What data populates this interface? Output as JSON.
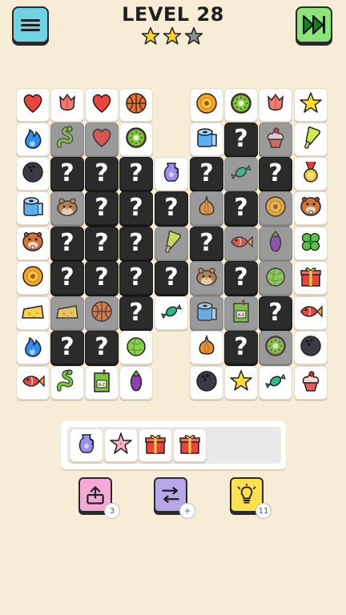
{
  "header": {
    "level_label": "LEVEL 28",
    "menu_icon": "hamburger-menu-icon",
    "skip_icon": "fast-forward-ad-icon",
    "stars_earned": 2,
    "stars_total": 3
  },
  "board": {
    "columns": 9,
    "rows": 9,
    "tiles": [
      {
        "row": 0,
        "col": 0,
        "item": "heart",
        "state": "open"
      },
      {
        "row": 0,
        "col": 1,
        "item": "tulip",
        "state": "open"
      },
      {
        "row": 0,
        "col": 2,
        "item": "heart",
        "state": "open"
      },
      {
        "row": 0,
        "col": 3,
        "item": "basketball",
        "state": "open"
      },
      {
        "row": 0,
        "col": 5,
        "item": "sunflower",
        "state": "open"
      },
      {
        "row": 0,
        "col": 6,
        "item": "kiwi",
        "state": "open"
      },
      {
        "row": 0,
        "col": 7,
        "item": "tulip",
        "state": "open"
      },
      {
        "row": 0,
        "col": 8,
        "item": "star",
        "state": "open"
      },
      {
        "row": 1,
        "col": 0,
        "item": "fire",
        "state": "open"
      },
      {
        "row": 1,
        "col": 1,
        "item": "snake",
        "state": "dim"
      },
      {
        "row": 1,
        "col": 2,
        "item": "heart",
        "state": "dim"
      },
      {
        "row": 1,
        "col": 3,
        "item": "kiwi",
        "state": "open"
      },
      {
        "row": 1,
        "col": 5,
        "item": "toilet-paper",
        "state": "open"
      },
      {
        "row": 1,
        "col": 6,
        "item": "",
        "state": "hidden"
      },
      {
        "row": 1,
        "col": 7,
        "item": "cupcake",
        "state": "dim"
      },
      {
        "row": 1,
        "col": 8,
        "item": "popsicle",
        "state": "open"
      },
      {
        "row": 2,
        "col": 0,
        "item": "bowling-ball",
        "state": "open"
      },
      {
        "row": 2,
        "col": 1,
        "item": "",
        "state": "hidden"
      },
      {
        "row": 2,
        "col": 2,
        "item": "",
        "state": "hidden"
      },
      {
        "row": 2,
        "col": 3,
        "item": "",
        "state": "hidden"
      },
      {
        "row": 2,
        "col": 4,
        "item": "vase",
        "state": "open"
      },
      {
        "row": 2,
        "col": 5,
        "item": "",
        "state": "hidden"
      },
      {
        "row": 2,
        "col": 6,
        "item": "candy",
        "state": "dim"
      },
      {
        "row": 2,
        "col": 7,
        "item": "",
        "state": "hidden"
      },
      {
        "row": 2,
        "col": 8,
        "item": "medal",
        "state": "open"
      },
      {
        "row": 3,
        "col": 0,
        "item": "toilet-paper",
        "state": "open"
      },
      {
        "row": 3,
        "col": 1,
        "item": "hamster",
        "state": "dim"
      },
      {
        "row": 3,
        "col": 2,
        "item": "",
        "state": "hidden"
      },
      {
        "row": 3,
        "col": 3,
        "item": "",
        "state": "hidden"
      },
      {
        "row": 3,
        "col": 4,
        "item": "",
        "state": "hidden"
      },
      {
        "row": 3,
        "col": 5,
        "item": "onion",
        "state": "dim"
      },
      {
        "row": 3,
        "col": 6,
        "item": "",
        "state": "hidden"
      },
      {
        "row": 3,
        "col": 7,
        "item": "sunflower",
        "state": "dim"
      },
      {
        "row": 3,
        "col": 8,
        "item": "beaver",
        "state": "open"
      },
      {
        "row": 4,
        "col": 0,
        "item": "beaver",
        "state": "open"
      },
      {
        "row": 4,
        "col": 1,
        "item": "",
        "state": "hidden"
      },
      {
        "row": 4,
        "col": 2,
        "item": "",
        "state": "hidden"
      },
      {
        "row": 4,
        "col": 3,
        "item": "",
        "state": "hidden"
      },
      {
        "row": 4,
        "col": 4,
        "item": "popsicle",
        "state": "dim"
      },
      {
        "row": 4,
        "col": 5,
        "item": "",
        "state": "hidden"
      },
      {
        "row": 4,
        "col": 6,
        "item": "fish",
        "state": "dim"
      },
      {
        "row": 4,
        "col": 7,
        "item": "eggplant",
        "state": "dim"
      },
      {
        "row": 4,
        "col": 8,
        "item": "clover",
        "state": "open"
      },
      {
        "row": 5,
        "col": 0,
        "item": "sunflower",
        "state": "open"
      },
      {
        "row": 5,
        "col": 1,
        "item": "",
        "state": "hidden"
      },
      {
        "row": 5,
        "col": 2,
        "item": "",
        "state": "hidden"
      },
      {
        "row": 5,
        "col": 3,
        "item": "",
        "state": "hidden"
      },
      {
        "row": 5,
        "col": 4,
        "item": "",
        "state": "hidden"
      },
      {
        "row": 5,
        "col": 5,
        "item": "hamster",
        "state": "dim"
      },
      {
        "row": 5,
        "col": 6,
        "item": "",
        "state": "hidden"
      },
      {
        "row": 5,
        "col": 7,
        "item": "cabbage",
        "state": "dim"
      },
      {
        "row": 5,
        "col": 8,
        "item": "gift",
        "state": "open"
      },
      {
        "row": 6,
        "col": 0,
        "item": "cheese",
        "state": "open"
      },
      {
        "row": 6,
        "col": 1,
        "item": "cheese",
        "state": "dim"
      },
      {
        "row": 6,
        "col": 2,
        "item": "basketball",
        "state": "dim"
      },
      {
        "row": 6,
        "col": 3,
        "item": "",
        "state": "hidden"
      },
      {
        "row": 6,
        "col": 4,
        "item": "candy",
        "state": "open"
      },
      {
        "row": 6,
        "col": 5,
        "item": "toilet-paper",
        "state": "dim"
      },
      {
        "row": 6,
        "col": 6,
        "item": "juice-box",
        "state": "dim"
      },
      {
        "row": 6,
        "col": 7,
        "item": "",
        "state": "hidden"
      },
      {
        "row": 6,
        "col": 8,
        "item": "fish",
        "state": "open"
      },
      {
        "row": 7,
        "col": 0,
        "item": "fire",
        "state": "open"
      },
      {
        "row": 7,
        "col": 1,
        "item": "",
        "state": "hidden"
      },
      {
        "row": 7,
        "col": 2,
        "item": "",
        "state": "hidden"
      },
      {
        "row": 7,
        "col": 3,
        "item": "cabbage",
        "state": "open"
      },
      {
        "row": 7,
        "col": 5,
        "item": "onion",
        "state": "open"
      },
      {
        "row": 7,
        "col": 6,
        "item": "",
        "state": "hidden"
      },
      {
        "row": 7,
        "col": 7,
        "item": "kiwi",
        "state": "dim"
      },
      {
        "row": 7,
        "col": 8,
        "item": "bowling-ball",
        "state": "open"
      },
      {
        "row": 8,
        "col": 0,
        "item": "fish",
        "state": "open"
      },
      {
        "row": 8,
        "col": 1,
        "item": "snake",
        "state": "open"
      },
      {
        "row": 8,
        "col": 2,
        "item": "juice-box",
        "state": "open"
      },
      {
        "row": 8,
        "col": 3,
        "item": "eggplant",
        "state": "open"
      },
      {
        "row": 8,
        "col": 5,
        "item": "bowling-ball",
        "state": "open"
      },
      {
        "row": 8,
        "col": 6,
        "item": "star",
        "state": "open"
      },
      {
        "row": 8,
        "col": 7,
        "item": "candy",
        "state": "open"
      },
      {
        "row": 8,
        "col": 8,
        "item": "cupcake",
        "state": "open"
      }
    ]
  },
  "tray": {
    "capacity": 7,
    "items": [
      "vase",
      "starfish",
      "gift",
      "gift"
    ]
  },
  "powerups": [
    {
      "name": "undo",
      "icon": "undo-arrow-icon",
      "count": "3",
      "color": "#f3a9d6"
    },
    {
      "name": "shuffle",
      "icon": "shuffle-icon",
      "count": "+",
      "color": "#b7a6e8"
    },
    {
      "name": "hint",
      "icon": "lightbulb-icon",
      "count": "11",
      "color": "#ffe14d"
    }
  ],
  "qmark_text": "?",
  "colors": {
    "background": "#f7ecd6",
    "hidden_tile": "#2b2b2b",
    "dim_tile": "#9a9a9a"
  }
}
